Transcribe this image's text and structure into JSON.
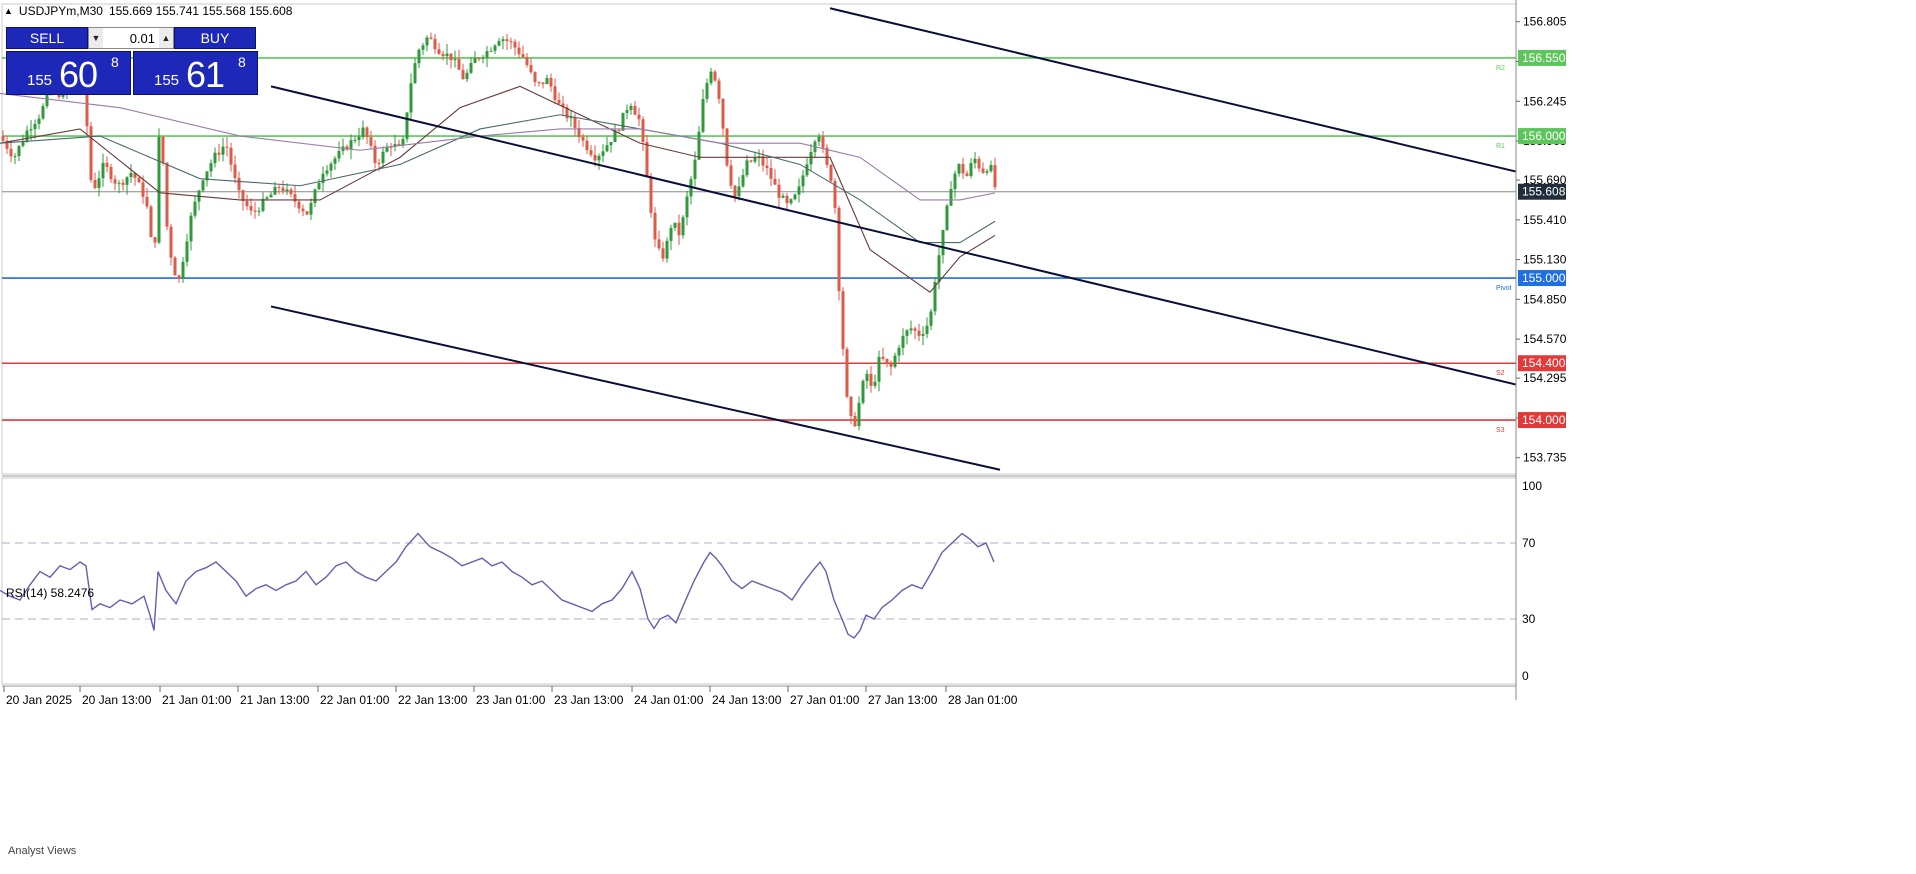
{
  "header": {
    "symbol": "USDJPYm,M30",
    "ohlc": "155.669 155.741 155.568 155.608"
  },
  "trade_panel": {
    "sell_label": "SELL",
    "buy_label": "BUY",
    "lot": "0.01",
    "sell_price": {
      "prefix": "155",
      "big": "60",
      "sup": "8"
    },
    "buy_price": {
      "prefix": "155",
      "big": "61",
      "sup": "8"
    }
  },
  "chart_data": {
    "type": "candlestick",
    "symbol": "USDJPYm",
    "timeframe": "M30",
    "ylim": [
      153.62,
      156.93
    ],
    "y_ticks": [
      "156.805",
      "156.525",
      "156.245",
      "155.965",
      "155.690",
      "155.410",
      "155.130",
      "154.850",
      "154.570",
      "154.295",
      "154.015",
      "153.735"
    ],
    "x_ticks": [
      "20 Jan 2025",
      "20 Jan 13:00",
      "21 Jan 01:00",
      "21 Jan 13:00",
      "22 Jan 01:00",
      "22 Jan 13:00",
      "23 Jan 01:00",
      "23 Jan 13:00",
      "24 Jan 01:00",
      "24 Jan 13:00",
      "27 Jan 01:00",
      "27 Jan 13:00",
      "28 Jan 01:00"
    ],
    "current_price": "155.608",
    "levels": [
      {
        "price": 156.55,
        "label": "156.550",
        "tag": "R2",
        "color": "#5cc65c"
      },
      {
        "price": 156.0,
        "label": "156.000",
        "tag": "R1",
        "color": "#5cc65c"
      },
      {
        "price": 155.0,
        "label": "155.000",
        "tag": "Pivot",
        "color": "#1e6fe0"
      },
      {
        "price": 154.4,
        "label": "154.400",
        "tag": "S2",
        "color": "#e03a3a"
      },
      {
        "price": 154.0,
        "label": "154.000",
        "tag": "S3",
        "color": "#e03a3a"
      }
    ],
    "close_path": [
      [
        0,
        156.0
      ],
      [
        14,
        155.85
      ],
      [
        28,
        156.05
      ],
      [
        40,
        156.15
      ],
      [
        52,
        156.35
      ],
      [
        62,
        156.28
      ],
      [
        74,
        156.4
      ],
      [
        84,
        156.35
      ],
      [
        92,
        155.6
      ],
      [
        104,
        155.8
      ],
      [
        118,
        155.65
      ],
      [
        132,
        155.75
      ],
      [
        146,
        155.55
      ],
      [
        154,
        155.1
      ],
      [
        160,
        156.15
      ],
      [
        168,
        155.25
      ],
      [
        178,
        154.95
      ],
      [
        190,
        155.4
      ],
      [
        202,
        155.7
      ],
      [
        214,
        155.85
      ],
      [
        226,
        155.95
      ],
      [
        238,
        155.6
      ],
      [
        252,
        155.45
      ],
      [
        266,
        155.55
      ],
      [
        280,
        155.65
      ],
      [
        294,
        155.55
      ],
      [
        308,
        155.45
      ],
      [
        322,
        155.75
      ],
      [
        336,
        155.85
      ],
      [
        350,
        155.95
      ],
      [
        364,
        156.05
      ],
      [
        376,
        155.8
      ],
      [
        390,
        155.95
      ],
      [
        402,
        155.9
      ],
      [
        410,
        156.35
      ],
      [
        418,
        156.6
      ],
      [
        428,
        156.7
      ],
      [
        440,
        156.6
      ],
      [
        452,
        156.55
      ],
      [
        464,
        156.4
      ],
      [
        476,
        156.55
      ],
      [
        488,
        156.6
      ],
      [
        500,
        156.7
      ],
      [
        512,
        156.65
      ],
      [
        524,
        156.55
      ],
      [
        536,
        156.35
      ],
      [
        548,
        156.4
      ],
      [
        560,
        156.2
      ],
      [
        572,
        156.1
      ],
      [
        584,
        155.95
      ],
      [
        596,
        155.85
      ],
      [
        608,
        155.95
      ],
      [
        618,
        156.05
      ],
      [
        630,
        156.25
      ],
      [
        640,
        156.1
      ],
      [
        648,
        155.65
      ],
      [
        656,
        155.2
      ],
      [
        664,
        155.15
      ],
      [
        672,
        155.4
      ],
      [
        680,
        155.3
      ],
      [
        688,
        155.6
      ],
      [
        696,
        155.85
      ],
      [
        704,
        156.3
      ],
      [
        712,
        156.5
      ],
      [
        720,
        156.25
      ],
      [
        728,
        155.75
      ],
      [
        736,
        155.55
      ],
      [
        746,
        155.8
      ],
      [
        758,
        155.85
      ],
      [
        768,
        155.75
      ],
      [
        778,
        155.6
      ],
      [
        788,
        155.5
      ],
      [
        798,
        155.6
      ],
      [
        808,
        155.85
      ],
      [
        818,
        156.05
      ],
      [
        826,
        155.8
      ],
      [
        834,
        155.65
      ],
      [
        838,
        155.05
      ],
      [
        842,
        154.6
      ],
      [
        848,
        154.05
      ],
      [
        854,
        153.95
      ],
      [
        860,
        154.15
      ],
      [
        866,
        154.35
      ],
      [
        872,
        154.2
      ],
      [
        880,
        154.45
      ],
      [
        890,
        154.35
      ],
      [
        900,
        154.55
      ],
      [
        910,
        154.65
      ],
      [
        920,
        154.6
      ],
      [
        930,
        154.7
      ],
      [
        936,
        155.05
      ],
      [
        944,
        155.35
      ],
      [
        952,
        155.7
      ],
      [
        960,
        155.8
      ],
      [
        966,
        155.7
      ],
      [
        974,
        155.85
      ],
      [
        982,
        155.75
      ],
      [
        990,
        155.8
      ],
      [
        996,
        155.61
      ]
    ],
    "ma_lines": [
      {
        "color": "#6a3a3a",
        "points": [
          [
            0,
            155.95
          ],
          [
            80,
            156.05
          ],
          [
            160,
            155.6
          ],
          [
            240,
            155.55
          ],
          [
            320,
            155.55
          ],
          [
            400,
            155.85
          ],
          [
            460,
            156.2
          ],
          [
            520,
            156.35
          ],
          [
            580,
            156.15
          ],
          [
            640,
            155.95
          ],
          [
            700,
            155.85
          ],
          [
            760,
            155.85
          ],
          [
            830,
            155.85
          ],
          [
            870,
            155.2
          ],
          [
            930,
            154.9
          ],
          [
            960,
            155.15
          ],
          [
            995,
            155.3
          ]
        ]
      },
      {
        "color": "#4a6a6a",
        "points": [
          [
            0,
            155.95
          ],
          [
            100,
            156.0
          ],
          [
            200,
            155.7
          ],
          [
            300,
            155.65
          ],
          [
            400,
            155.8
          ],
          [
            480,
            156.05
          ],
          [
            560,
            156.15
          ],
          [
            640,
            156.05
          ],
          [
            720,
            155.95
          ],
          [
            800,
            155.8
          ],
          [
            860,
            155.55
          ],
          [
            920,
            155.25
          ],
          [
            960,
            155.25
          ],
          [
            995,
            155.4
          ]
        ]
      },
      {
        "color": "#9a7aa8",
        "points": [
          [
            0,
            156.3
          ],
          [
            120,
            156.2
          ],
          [
            240,
            156.0
          ],
          [
            360,
            155.9
          ],
          [
            480,
            156.0
          ],
          [
            560,
            156.05
          ],
          [
            640,
            156.05
          ],
          [
            720,
            155.95
          ],
          [
            800,
            155.95
          ],
          [
            860,
            155.85
          ],
          [
            920,
            155.55
          ],
          [
            960,
            155.55
          ],
          [
            995,
            155.6
          ]
        ]
      }
    ],
    "channel_lines": [
      {
        "p1": [
          271,
          154.8
        ],
        "p2": [
          1000,
          153.65
        ]
      },
      {
        "p1": [
          271,
          156.35
        ],
        "p2": [
          1516,
          154.25
        ]
      },
      {
        "p1": [
          830,
          156.9
        ],
        "p2": [
          1516,
          155.75
        ]
      }
    ],
    "rsi": {
      "label": "RSI(14) 58.2476",
      "ylim": [
        0,
        100
      ],
      "levels": [
        70,
        30
      ],
      "y_ticks": [
        "100",
        "70",
        "30",
        "0"
      ],
      "values": [
        [
          0,
          45
        ],
        [
          10,
          42
        ],
        [
          20,
          40
        ],
        [
          30,
          48
        ],
        [
          40,
          55
        ],
        [
          50,
          52
        ],
        [
          60,
          58
        ],
        [
          70,
          56
        ],
        [
          80,
          60
        ],
        [
          86,
          58
        ],
        [
          92,
          35
        ],
        [
          100,
          38
        ],
        [
          110,
          36
        ],
        [
          120,
          40
        ],
        [
          132,
          38
        ],
        [
          144,
          42
        ],
        [
          150,
          32
        ],
        [
          154,
          24
        ],
        [
          158,
          55
        ],
        [
          166,
          45
        ],
        [
          176,
          38
        ],
        [
          186,
          50
        ],
        [
          196,
          55
        ],
        [
          206,
          57
        ],
        [
          216,
          60
        ],
        [
          226,
          55
        ],
        [
          236,
          50
        ],
        [
          246,
          42
        ],
        [
          256,
          46
        ],
        [
          266,
          48
        ],
        [
          276,
          45
        ],
        [
          286,
          48
        ],
        [
          296,
          50
        ],
        [
          306,
          55
        ],
        [
          316,
          48
        ],
        [
          326,
          52
        ],
        [
          336,
          58
        ],
        [
          346,
          60
        ],
        [
          356,
          55
        ],
        [
          366,
          52
        ],
        [
          376,
          50
        ],
        [
          386,
          55
        ],
        [
          396,
          60
        ],
        [
          406,
          68
        ],
        [
          418,
          75
        ],
        [
          430,
          68
        ],
        [
          442,
          65
        ],
        [
          452,
          62
        ],
        [
          462,
          58
        ],
        [
          472,
          60
        ],
        [
          482,
          62
        ],
        [
          492,
          58
        ],
        [
          502,
          60
        ],
        [
          512,
          55
        ],
        [
          522,
          52
        ],
        [
          532,
          48
        ],
        [
          542,
          50
        ],
        [
          552,
          45
        ],
        [
          562,
          40
        ],
        [
          572,
          38
        ],
        [
          582,
          36
        ],
        [
          592,
          34
        ],
        [
          602,
          38
        ],
        [
          612,
          40
        ],
        [
          622,
          46
        ],
        [
          632,
          55
        ],
        [
          640,
          46
        ],
        [
          648,
          30
        ],
        [
          654,
          25
        ],
        [
          660,
          30
        ],
        [
          668,
          32
        ],
        [
          676,
          28
        ],
        [
          684,
          38
        ],
        [
          694,
          50
        ],
        [
          704,
          60
        ],
        [
          710,
          65
        ],
        [
          716,
          62
        ],
        [
          722,
          58
        ],
        [
          732,
          50
        ],
        [
          742,
          46
        ],
        [
          752,
          50
        ],
        [
          762,
          48
        ],
        [
          772,
          46
        ],
        [
          782,
          44
        ],
        [
          792,
          40
        ],
        [
          802,
          48
        ],
        [
          812,
          55
        ],
        [
          820,
          60
        ],
        [
          826,
          55
        ],
        [
          834,
          40
        ],
        [
          842,
          30
        ],
        [
          848,
          22
        ],
        [
          854,
          20
        ],
        [
          860,
          24
        ],
        [
          866,
          32
        ],
        [
          874,
          30
        ],
        [
          882,
          36
        ],
        [
          892,
          40
        ],
        [
          902,
          45
        ],
        [
          912,
          48
        ],
        [
          922,
          46
        ],
        [
          932,
          55
        ],
        [
          942,
          65
        ],
        [
          952,
          70
        ],
        [
          962,
          75
        ],
        [
          970,
          72
        ],
        [
          978,
          68
        ],
        [
          986,
          70
        ],
        [
          994,
          60
        ]
      ]
    }
  }
}
